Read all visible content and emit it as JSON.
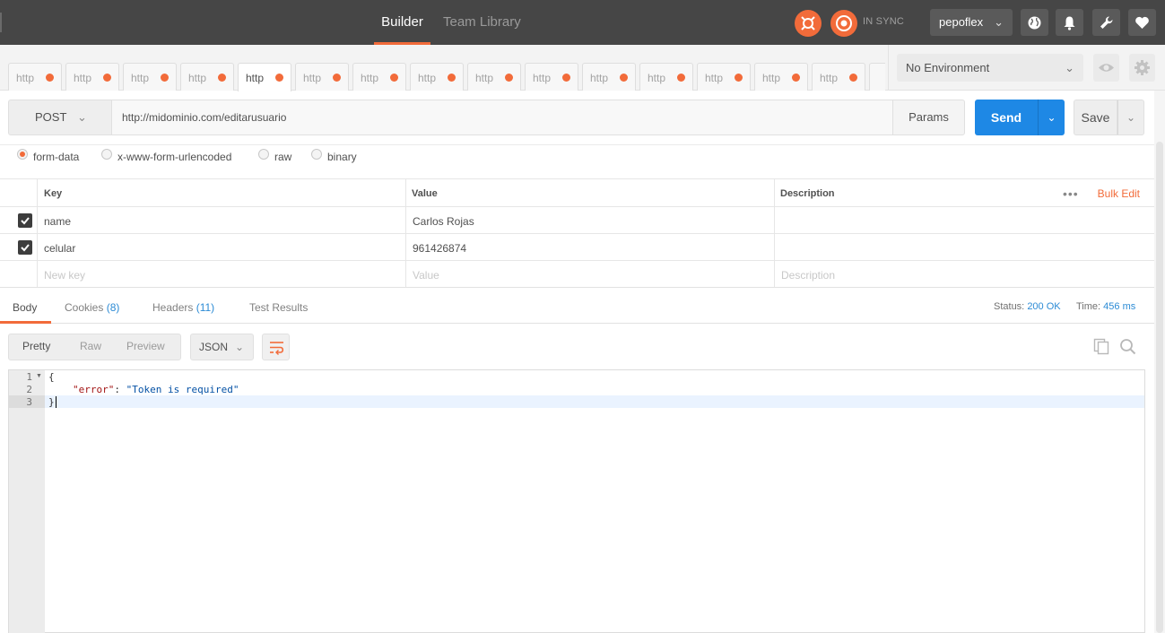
{
  "topbar": {
    "tab_builder": "Builder",
    "tab_team_library": "Team Library",
    "sync_status": "IN SYNC",
    "username": "pepoflex",
    "accent_color": "#f26b3a"
  },
  "request_tabs": [
    {
      "label": "http"
    },
    {
      "label": "http"
    },
    {
      "label": "http"
    },
    {
      "label": "http"
    },
    {
      "label": "http",
      "active": true
    },
    {
      "label": "http"
    },
    {
      "label": "http"
    },
    {
      "label": "http"
    },
    {
      "label": "http"
    },
    {
      "label": "http"
    },
    {
      "label": "http"
    },
    {
      "label": "http"
    },
    {
      "label": "http"
    },
    {
      "label": "http"
    },
    {
      "label": "http"
    }
  ],
  "environment": {
    "selected": "No Environment"
  },
  "request": {
    "method": "POST",
    "url": "http://midominio.com/editarusuario",
    "params_label": "Params",
    "send_label": "Send",
    "save_label": "Save"
  },
  "body_types": {
    "form_data": "form-data",
    "urlencoded": "x-www-form-urlencoded",
    "raw": "raw",
    "binary": "binary",
    "selected": "form-data"
  },
  "params_table": {
    "headers": {
      "key": "Key",
      "value": "Value",
      "description": "Description"
    },
    "bulk_edit": "Bulk Edit",
    "rows": [
      {
        "key": "name",
        "value": "Carlos Rojas",
        "description": "",
        "checked": true
      },
      {
        "key": "celular",
        "value": "961426874",
        "description": "",
        "checked": true
      }
    ],
    "placeholders": {
      "key": "New key",
      "value": "Value",
      "description": "Description"
    }
  },
  "response": {
    "tabs": {
      "body": "Body",
      "cookies": "Cookies",
      "cookies_count": "(8)",
      "headers": "Headers",
      "headers_count": "(11)",
      "tests": "Test Results"
    },
    "status_label": "Status:",
    "status_value": "200 OK",
    "time_label": "Time:",
    "time_value": "456 ms",
    "views": {
      "pretty": "Pretty",
      "raw": "Raw",
      "preview": "Preview"
    },
    "format": "JSON",
    "code_lines": {
      "n1": "1",
      "n2": "2",
      "n3": "3",
      "l1": "{",
      "l2_key": "\"error\"",
      "l2_colon": ": ",
      "l2_val": "\"Token is required\"",
      "l3": "}"
    }
  }
}
